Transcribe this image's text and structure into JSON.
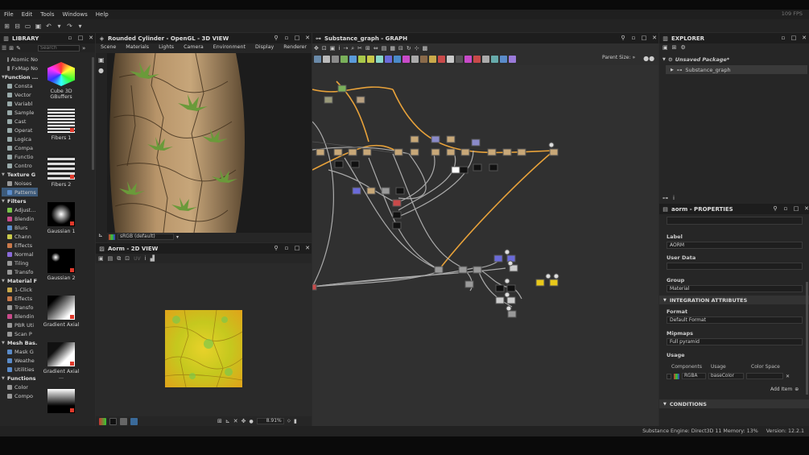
{
  "menu": {
    "file": "File",
    "edit": "Edit",
    "tools": "Tools",
    "windows": "Windows",
    "help": "Help",
    "fps": "109 FPS"
  },
  "library": {
    "title": "LIBRARY",
    "search_placeholder": "Search",
    "tree": [
      {
        "label": "Atomic No",
        "type": "item",
        "color": "#8a8a8a"
      },
      {
        "label": "FxMap No",
        "type": "item",
        "color": "#8a8a8a"
      },
      {
        "label": "Function ...",
        "type": "sec"
      },
      {
        "label": "Consta",
        "type": "item",
        "color": "#9aa"
      },
      {
        "label": "Vector",
        "type": "item",
        "color": "#9aa"
      },
      {
        "label": "Variabl",
        "type": "item",
        "color": "#9aa"
      },
      {
        "label": "Sample",
        "type": "item",
        "color": "#9aa"
      },
      {
        "label": "Cast",
        "type": "item",
        "color": "#9aa"
      },
      {
        "label": "Operat",
        "type": "item",
        "color": "#9aa"
      },
      {
        "label": "Logica",
        "type": "item",
        "color": "#9aa"
      },
      {
        "label": "Compa",
        "type": "item",
        "color": "#9aa"
      },
      {
        "label": "Functio",
        "type": "item",
        "color": "#9aa"
      },
      {
        "label": "Contro",
        "type": "item",
        "color": "#9aa"
      },
      {
        "label": "Texture G",
        "type": "sec"
      },
      {
        "label": "Noises",
        "type": "item",
        "color": "#999"
      },
      {
        "label": "Patterns",
        "type": "item",
        "color": "#5a8bc9",
        "selected": true
      },
      {
        "label": "Filters",
        "type": "sec"
      },
      {
        "label": "Adjust...",
        "type": "item",
        "color": "#7bc24a"
      },
      {
        "label": "Blendin",
        "type": "item",
        "color": "#c94a8a"
      },
      {
        "label": "Blurs",
        "type": "item",
        "color": "#5a8bc9"
      },
      {
        "label": "Chann",
        "type": "item",
        "color": "#c9c94a"
      },
      {
        "label": "Effects",
        "type": "item",
        "color": "#c9794a"
      },
      {
        "label": "Normal",
        "type": "item",
        "color": "#8a6ad9"
      },
      {
        "label": "Tiling",
        "type": "item",
        "color": "#999"
      },
      {
        "label": "Transfo",
        "type": "item",
        "color": "#999"
      },
      {
        "label": "Material F",
        "type": "sec"
      },
      {
        "label": "1-Click",
        "type": "item",
        "color": "#c9a94a"
      },
      {
        "label": "Effects",
        "type": "item",
        "color": "#c9794a"
      },
      {
        "label": "Transfo",
        "type": "item",
        "color": "#999"
      },
      {
        "label": "Blendin",
        "type": "item",
        "color": "#c94a8a"
      },
      {
        "label": "PBR Uti",
        "type": "item",
        "color": "#999"
      },
      {
        "label": "Scan P",
        "type": "item",
        "color": "#999"
      },
      {
        "label": "Mesh Bas.",
        "type": "sec"
      },
      {
        "label": "Mask G",
        "type": "item",
        "color": "#5a8bc9"
      },
      {
        "label": "Weathe",
        "type": "item",
        "color": "#5a8bc9"
      },
      {
        "label": "Utilities",
        "type": "item",
        "color": "#5a8bc9"
      },
      {
        "label": "Functions",
        "type": "sec"
      },
      {
        "label": "Color",
        "type": "item",
        "color": "#999"
      },
      {
        "label": "Compo",
        "type": "item",
        "color": "#999"
      }
    ],
    "thumbs": [
      {
        "label": "Cube 3D GBuffers"
      },
      {
        "label": "Fibers 1"
      },
      {
        "label": "Fibers 2"
      },
      {
        "label": "Gaussian 1"
      },
      {
        "label": "Gaussian 2"
      },
      {
        "label": "Gradient Axial"
      },
      {
        "label": "Gradient Axial ..."
      },
      {
        "label": ""
      }
    ]
  },
  "view3d": {
    "title": "Rounded Cylinder - OpenGL - 3D VIEW",
    "menu": [
      "Scene",
      "Materials",
      "Lights",
      "Camera",
      "Environment",
      "Display",
      "Renderer"
    ],
    "colorspace": "sRGB (default)"
  },
  "view2d": {
    "title": "Aorm - 2D VIEW",
    "zoom": "8.91%",
    "uv_label": "UV"
  },
  "graph": {
    "title": "Substance_graph - GRAPH",
    "parent_size_label": "Parent Size:",
    "parent_size_value": "..."
  },
  "explorer": {
    "title": "EXPLORER",
    "package": "Unsaved Package*",
    "graph": "Substance_graph"
  },
  "properties": {
    "title": "aorm - PROPERTIES",
    "label_title": "Label",
    "label_value": "AORM",
    "user_data_title": "User Data",
    "group_title": "Group",
    "group_value": "Material",
    "integration_title": "INTEGRATION ATTRIBUTES",
    "format_title": "Format",
    "format_value": "Default Format",
    "mipmaps_title": "Mipmaps",
    "mipmaps_value": "Full pyramid",
    "usage_title": "Usage",
    "col_components": "Components",
    "col_usage": "Usage",
    "col_colorspace": "Color Space",
    "components_value": "RGBA",
    "usage_value": "baseColor",
    "add_item": "Add Item",
    "conditions_title": "CONDITIONS"
  },
  "status": {
    "engine": "Substance Engine: Direct3D 11  Memory: 13%",
    "version": "Version: 12.2.1"
  }
}
